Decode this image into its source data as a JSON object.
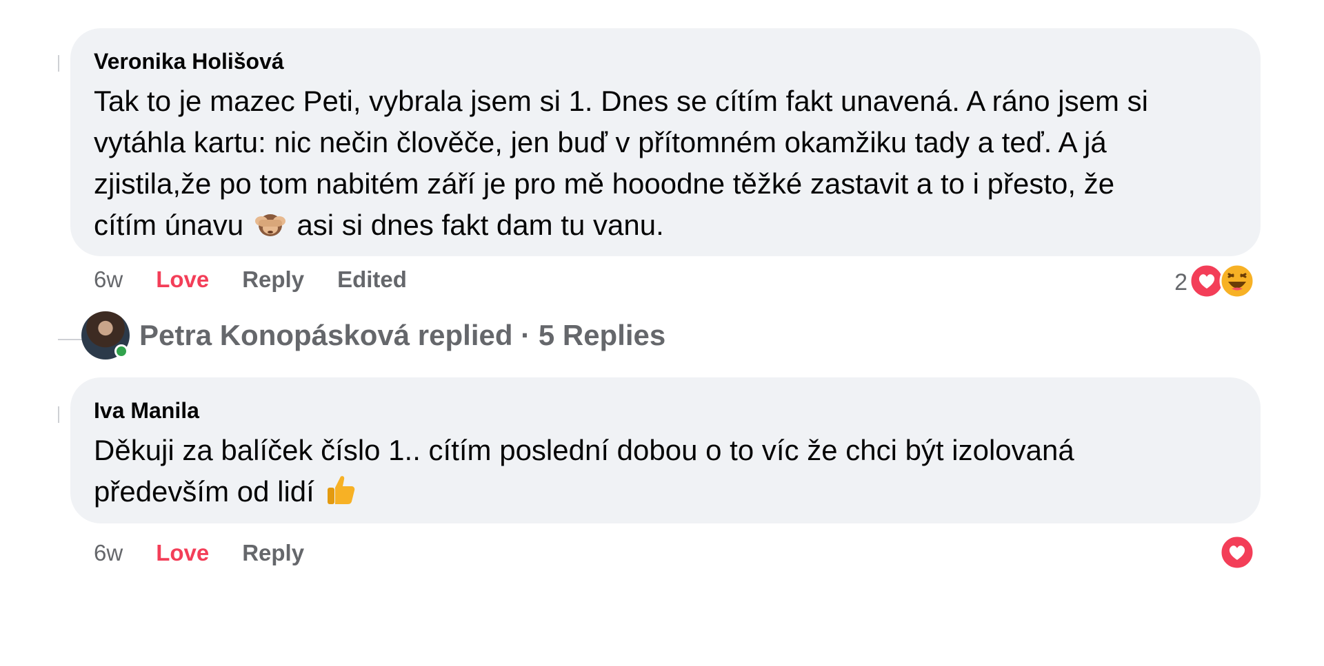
{
  "comments": [
    {
      "author": "Veronika Holišová",
      "text_line1": "Tak to je mazec Peti, vybrala jsem si 1. Dnes se cítím fakt unavená. A ráno jsem si",
      "text_line2": "vytáhla kartu: nic nečin člověče, jen buď v přítomném okamžiku tady a teď. A já",
      "text_line3": "zjistila,že po tom nabitém září je pro mě hooodne těžké zastavit a to i přesto, že",
      "text_line4a": "cítím únavu",
      "text_line4b": "asi si dnes fakt dam tu vanu.",
      "emoji": "see-no-evil-monkey-icon",
      "time": "6w",
      "love_label": "Love",
      "reply_label": "Reply",
      "edited_label": "Edited",
      "reaction_count": "2",
      "reactions": [
        "heart-icon",
        "laughing-icon"
      ]
    },
    {
      "author": "Iva Manila",
      "text_line1": "Děkuji za balíček číslo 1.. cítím poslední dobou o to víc že chci být izolovaná",
      "text_line2": "především od lidí",
      "emoji": "thumbs-up-icon",
      "time": "6w",
      "love_label": "Love",
      "reply_label": "Reply",
      "reactions": [
        "heart-icon"
      ]
    }
  ],
  "replies_summary": {
    "text": "Petra Konopásková replied · 5 Replies",
    "online": true
  },
  "colors": {
    "bubble": "#f0f2f5",
    "love": "#f33e58",
    "muted": "#65676b",
    "text": "#050505",
    "online": "#31a24c"
  }
}
